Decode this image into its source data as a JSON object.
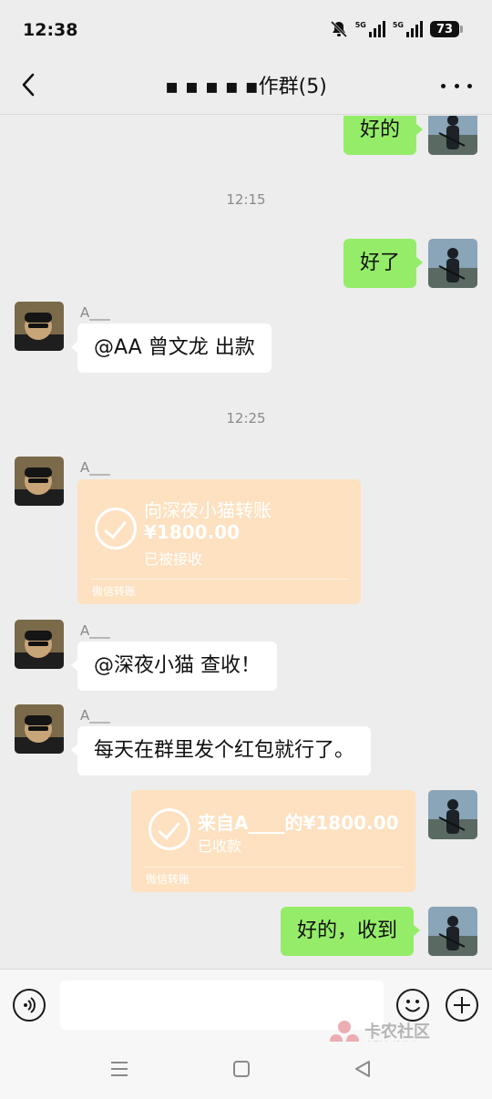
{
  "status_bar": {
    "time": "12:38",
    "network_1": "5G",
    "network_2": "5G",
    "battery": "73"
  },
  "header": {
    "title": "▪ ▪ ▪ ▪ ▪作群(5)"
  },
  "messages": [
    {
      "type": "text",
      "side": "right",
      "text": "好的"
    },
    {
      "type": "time",
      "text": "12:15"
    },
    {
      "type": "text",
      "side": "right",
      "text": "好了"
    },
    {
      "type": "text",
      "side": "left",
      "sender": "A___",
      "text": "@AA 曾文龙  出款"
    },
    {
      "type": "time",
      "text": "12:25"
    },
    {
      "type": "transfer",
      "side": "left",
      "sender": "A___",
      "title": "向深夜小猫转账",
      "amount": "¥1800.00",
      "status": "已被接收",
      "footer": "微信转账"
    },
    {
      "type": "text",
      "side": "left",
      "sender": "A___",
      "text": "@深夜小猫  查收！"
    },
    {
      "type": "text",
      "side": "left",
      "sender": "A___",
      "text": "每天在群里发个红包就行了。"
    },
    {
      "type": "transfer",
      "side": "right",
      "title": "来自A____的¥1800.00",
      "status": "已收款",
      "footer": "微信转账"
    },
    {
      "type": "text",
      "side": "right",
      "text": "好的，收到"
    }
  ],
  "input_bar": {
    "voice_icon": "voice-icon",
    "emoji_icon": "emoji-icon",
    "plus_icon": "plus-icon"
  },
  "watermark": {
    "title": "卡农社区",
    "subtitle": "金融在线教育"
  },
  "colors": {
    "my_bubble": "#95ec69",
    "their_bubble": "#ffffff",
    "transfer_card": "#fde1c0",
    "background": "#ededed"
  }
}
